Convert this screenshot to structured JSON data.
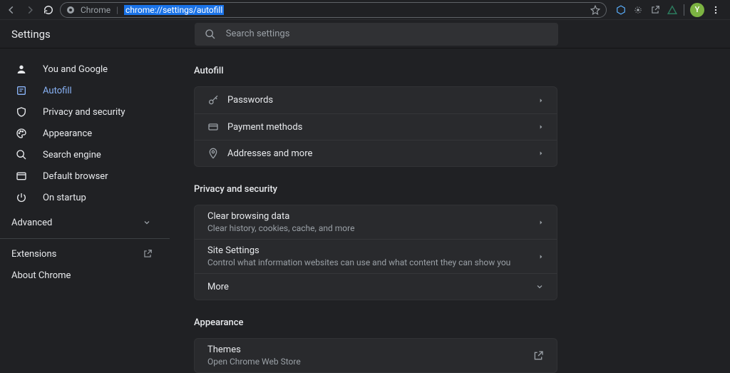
{
  "chrome_bar": {
    "chip": "Chrome",
    "url": "chrome://settings/autofill",
    "avatar_initial": "Y"
  },
  "header": {
    "title": "Settings",
    "search_placeholder": "Search settings"
  },
  "sidebar": {
    "items": [
      {
        "label": "You and Google"
      },
      {
        "label": "Autofill"
      },
      {
        "label": "Privacy and security"
      },
      {
        "label": "Appearance"
      },
      {
        "label": "Search engine"
      },
      {
        "label": "Default browser"
      },
      {
        "label": "On startup"
      }
    ],
    "advanced": "Advanced",
    "links": {
      "extensions": "Extensions",
      "about": "About Chrome"
    }
  },
  "sections": {
    "autofill": {
      "title": "Autofill",
      "rows": [
        {
          "label": "Passwords"
        },
        {
          "label": "Payment methods"
        },
        {
          "label": "Addresses and more"
        }
      ]
    },
    "privacy": {
      "title": "Privacy and security",
      "rows": [
        {
          "label": "Clear browsing data",
          "sub": "Clear history, cookies, cache, and more"
        },
        {
          "label": "Site Settings",
          "sub": "Control what information websites can use and what content they can show you"
        },
        {
          "label": "More"
        }
      ]
    },
    "appearance": {
      "title": "Appearance",
      "rows": [
        {
          "label": "Themes",
          "sub": "Open Chrome Web Store"
        }
      ]
    }
  }
}
